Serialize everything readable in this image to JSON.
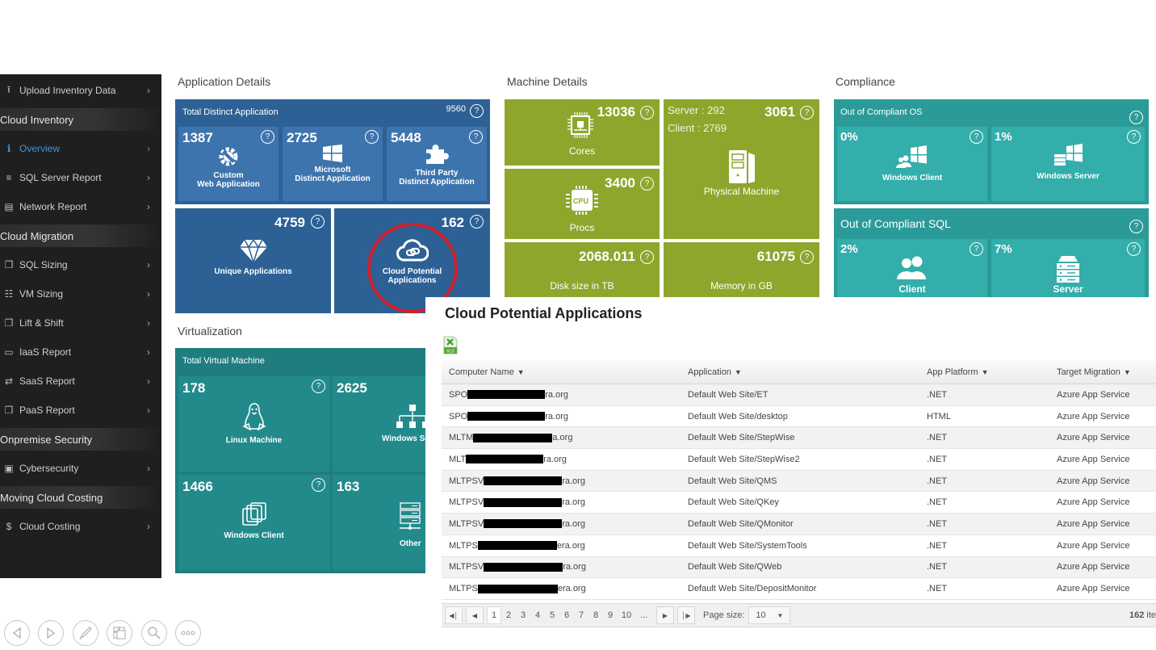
{
  "sidebar": {
    "items": [
      {
        "type": "item",
        "label": "Upload Inventory Data",
        "icon": "upload-icon"
      },
      {
        "type": "header",
        "label": "Cloud Inventory"
      },
      {
        "type": "item",
        "label": "Overview",
        "icon": "info-icon",
        "active": true
      },
      {
        "type": "item",
        "label": "SQL Server Report",
        "icon": "database-icon"
      },
      {
        "type": "item",
        "label": "Network Report",
        "icon": "network-icon"
      },
      {
        "type": "header",
        "label": "Cloud Migration"
      },
      {
        "type": "item",
        "label": "SQL Sizing",
        "icon": "copy-icon"
      },
      {
        "type": "item",
        "label": "VM Sizing",
        "icon": "document-icon"
      },
      {
        "type": "item",
        "label": "Lift & Shift",
        "icon": "copy-icon"
      },
      {
        "type": "item",
        "label": "IaaS Report",
        "icon": "monitor-icon"
      },
      {
        "type": "item",
        "label": "SaaS Report",
        "icon": "exchange-icon"
      },
      {
        "type": "item",
        "label": "PaaS Report",
        "icon": "file-icon"
      },
      {
        "type": "header",
        "label": "Onpremise Security"
      },
      {
        "type": "item",
        "label": "Cybersecurity",
        "icon": "lock-icon"
      },
      {
        "type": "header",
        "label": "Moving Cloud Costing"
      },
      {
        "type": "item",
        "label": "Cloud Costing",
        "icon": "dollar-icon"
      }
    ]
  },
  "app_details": {
    "title": "Application Details",
    "total_label": "Total Distinct Application",
    "total_value": "9560",
    "custom": {
      "value": "1387",
      "label1": "Custom",
      "label2": "Web Application"
    },
    "microsoft": {
      "value": "2725",
      "label1": "Microsoft",
      "label2": "Distinct Application"
    },
    "third_party": {
      "value": "5448",
      "label1": "Third Party",
      "label2": "Distinct Application"
    },
    "unique": {
      "value": "4759",
      "label": "Unique Applications"
    },
    "cloud_potential": {
      "value": "162",
      "label1": "Cloud Potential",
      "label2": "Applications"
    }
  },
  "machine_details": {
    "title": "Machine Details",
    "cores": {
      "value": "13036",
      "label": "Cores"
    },
    "procs": {
      "value": "3400",
      "label": "Procs",
      "chip_text": "CPU"
    },
    "physical": {
      "value": "3061",
      "server": "Server : 292",
      "client": "Client : 2769",
      "label": "Physical Machine"
    },
    "disk": {
      "value": "2068.011",
      "label": "Disk size in TB"
    },
    "memory": {
      "value": "61075",
      "label": "Memory in GB"
    }
  },
  "compliance": {
    "title": "Compliance",
    "os": {
      "title": "Out of Compliant OS",
      "client": {
        "value": "0%",
        "label": "Windows Client"
      },
      "server": {
        "value": "1%",
        "label": "Windows Server"
      }
    },
    "sql": {
      "title": "Out of Compliant SQL",
      "client": {
        "value": "2%",
        "label": "Client"
      },
      "server": {
        "value": "7%",
        "label": "Server"
      }
    }
  },
  "virtualization": {
    "title": "Virtualization",
    "total_label": "Total Virtual Machine",
    "linux": {
      "value": "178",
      "label": "Linux Machine"
    },
    "windows_server": {
      "value": "2625",
      "label": "Windows Ser"
    },
    "windows_client": {
      "value": "1466",
      "label": "Windows Client"
    },
    "other": {
      "value": "163",
      "label": "Other"
    }
  },
  "cloud_potential_panel": {
    "title": "Cloud Potential Applications",
    "export_label": "XLS",
    "columns": [
      "Computer Name",
      "Application",
      "App Platform",
      "Target Migration"
    ],
    "rows": [
      {
        "computer_prefix": "SPO",
        "computer_suffix": "ra.org",
        "application": "Default Web Site/ET",
        "platform": ".NET",
        "target": "Azure App Service"
      },
      {
        "computer_prefix": "SPO",
        "computer_suffix": "ra.org",
        "application": "Default Web Site/desktop",
        "platform": "HTML",
        "target": "Azure App Service"
      },
      {
        "computer_prefix": "MLTM",
        "computer_suffix": "a.org",
        "application": "Default Web Site/StepWise",
        "platform": ".NET",
        "target": "Azure App Service"
      },
      {
        "computer_prefix": "MLT",
        "computer_suffix": "ra.org",
        "application": "Default Web Site/StepWise2",
        "platform": ".NET",
        "target": "Azure App Service"
      },
      {
        "computer_prefix": "MLTPSV",
        "computer_suffix": "ra.org",
        "application": "Default Web Site/QMS",
        "platform": ".NET",
        "target": "Azure App Service"
      },
      {
        "computer_prefix": "MLTPSV",
        "computer_suffix": "ra.org",
        "application": "Default Web Site/QKey",
        "platform": ".NET",
        "target": "Azure App Service"
      },
      {
        "computer_prefix": "MLTPSV",
        "computer_suffix": "ra.org",
        "application": "Default Web Site/QMonitor",
        "platform": ".NET",
        "target": "Azure App Service"
      },
      {
        "computer_prefix": "MLTPS",
        "computer_suffix": "era.org",
        "application": "Default Web Site/SystemTools",
        "platform": ".NET",
        "target": "Azure App Service"
      },
      {
        "computer_prefix": "MLTPSV",
        "computer_suffix": "ra.org",
        "application": "Default Web Site/QWeb",
        "platform": ".NET",
        "target": "Azure App Service"
      },
      {
        "computer_prefix": "MLTPS",
        "computer_suffix": "era.org",
        "application": "Default Web Site/DepositMonitor",
        "platform": ".NET",
        "target": "Azure App Service"
      }
    ],
    "pager": {
      "pages": [
        "1",
        "2",
        "3",
        "4",
        "5",
        "6",
        "7",
        "8",
        "9",
        "10",
        "..."
      ],
      "current_page": "1",
      "page_size_label": "Page size:",
      "page_size": "10",
      "count_value": "162",
      "count_suffix": "ite"
    }
  },
  "help_glyph": "?",
  "colors": {
    "sidebar_bg": "#1f1f1f",
    "active_link": "#4a90d9",
    "app_blue": "#2d6196",
    "machine_green": "#8fa62d",
    "compliance_teal": "#33aeab",
    "virtualization_teal": "#238a8c",
    "highlight_circle": "#d0202a"
  }
}
